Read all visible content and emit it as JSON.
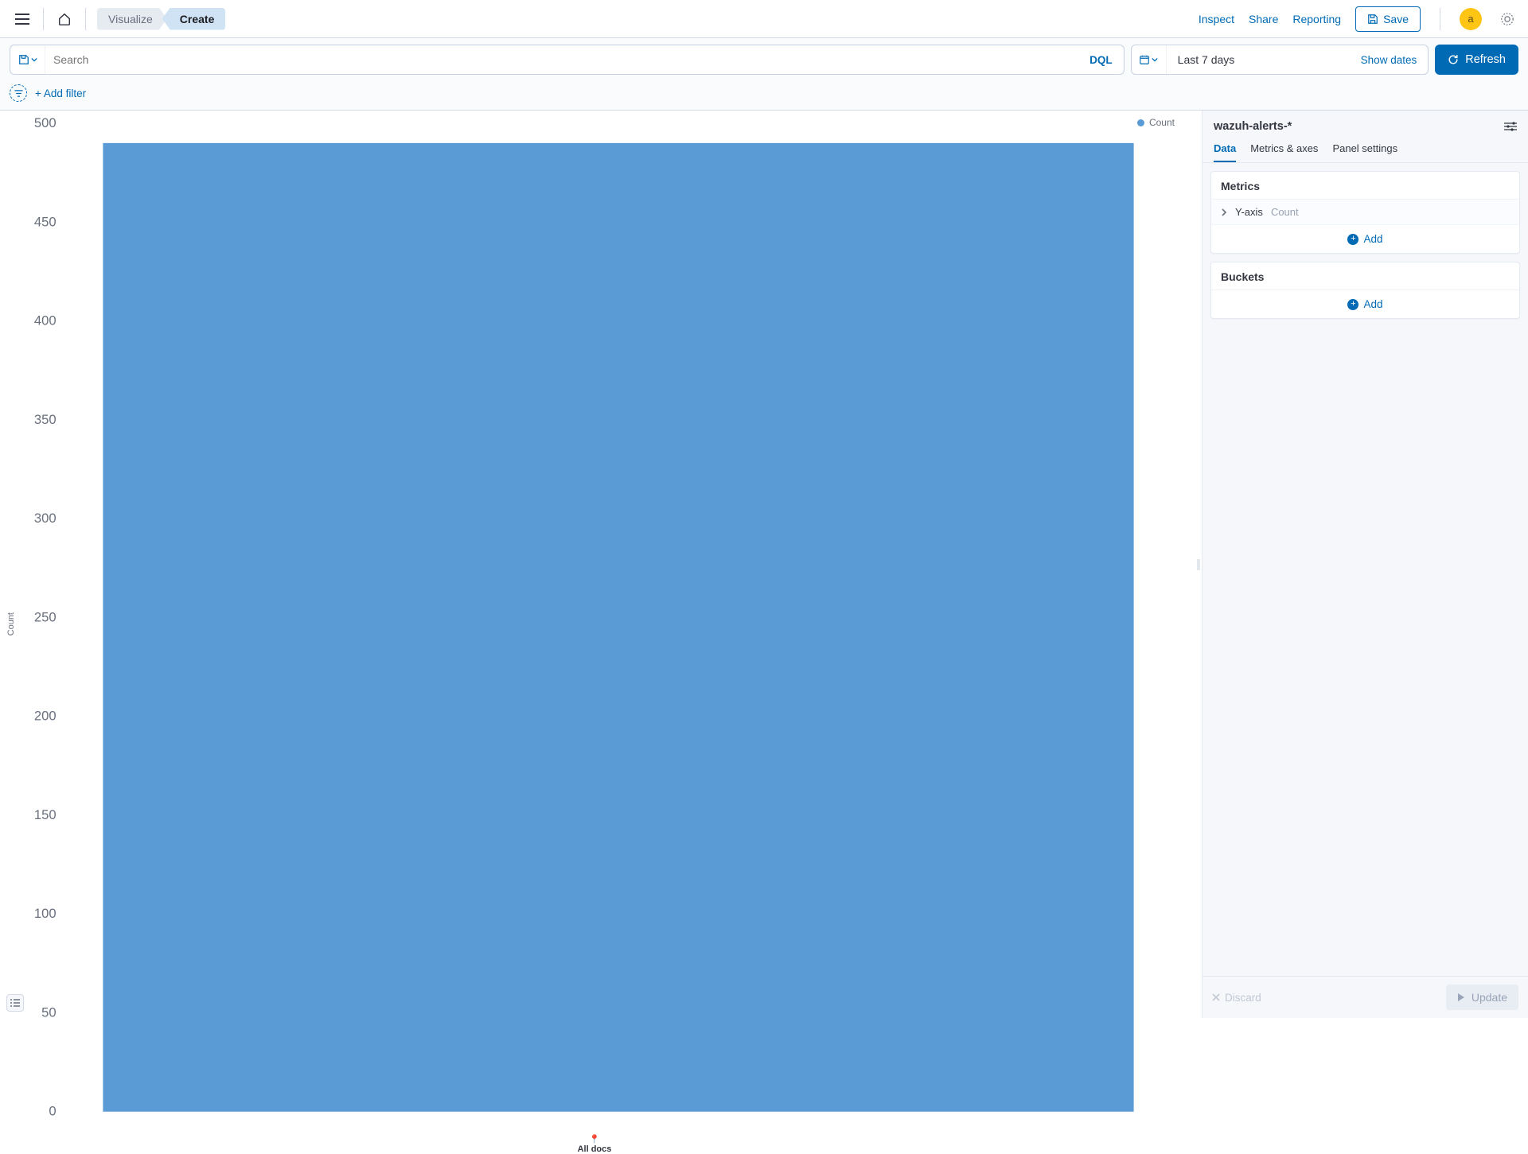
{
  "header": {
    "breadcrumb_prev": "Visualize",
    "breadcrumb_current": "Create",
    "links": {
      "inspect": "Inspect",
      "share": "Share",
      "reporting": "Reporting"
    },
    "save_label": "Save",
    "avatar_initial": "a"
  },
  "query": {
    "search_placeholder": "Search",
    "dql_label": "DQL",
    "time_label": "Last 7 days",
    "show_dates": "Show dates",
    "refresh_label": "Refresh",
    "add_filter": "+ Add filter"
  },
  "panel": {
    "index_pattern": "wazuh-alerts-*",
    "tabs": {
      "data": "Data",
      "metrics_axes": "Metrics & axes",
      "panel_settings": "Panel settings"
    },
    "metrics_title": "Metrics",
    "metric_axis": "Y-axis",
    "metric_agg": "Count",
    "buckets_title": "Buckets",
    "add_label": "Add",
    "discard_label": "Discard",
    "update_label": "Update"
  },
  "chart_data": {
    "type": "bar",
    "title": "",
    "xlabel": "",
    "ylabel": "Count",
    "legend": [
      "Count"
    ],
    "categories": [
      "All docs"
    ],
    "values": [
      490
    ],
    "ylim": [
      0,
      500
    ],
    "yticks": [
      0,
      50,
      100,
      150,
      200,
      250,
      300,
      350,
      400,
      450,
      500
    ],
    "bar_color": "#5B9BD5"
  },
  "chart_ui": {
    "x_category_label": "All docs"
  }
}
